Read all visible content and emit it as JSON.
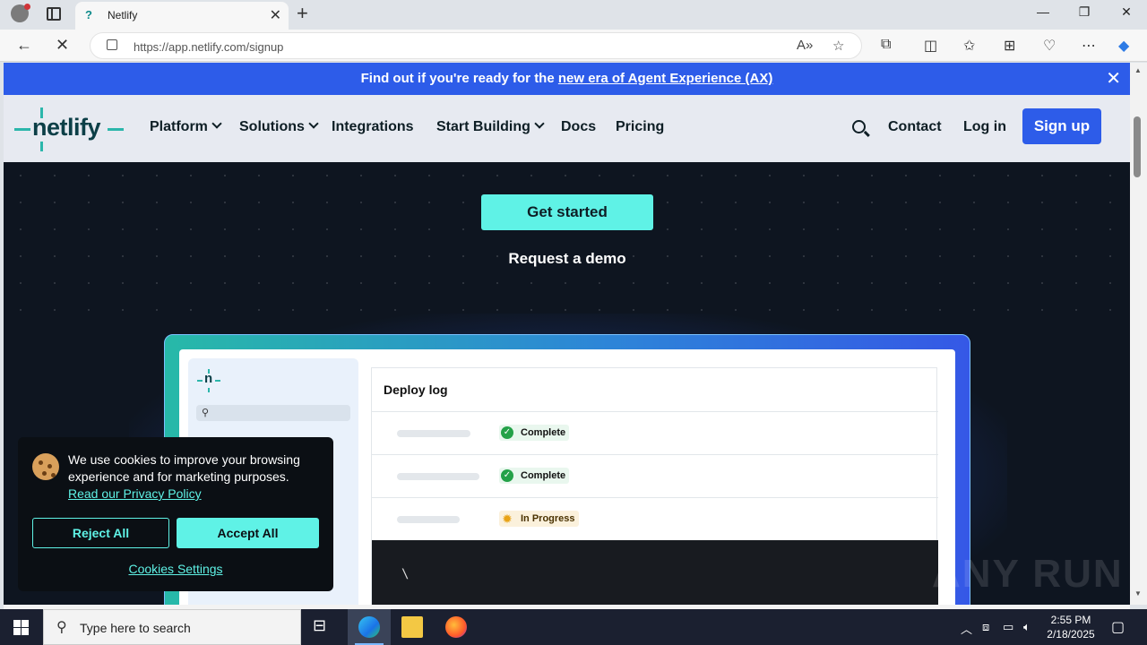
{
  "browser": {
    "tab_title": "Netlify",
    "tab_favicon": "?",
    "new_tab_symbol": "+",
    "url": "https://app.netlify.com/signup",
    "window_controls": [
      "—",
      "❐",
      "✕"
    ],
    "back_symbol": "←",
    "reload_symbol": "✕",
    "close_tab_symbol": "✕"
  },
  "banner": {
    "prefix": "Find out if you're ready for the ",
    "link": "new era of Agent Experience (AX)",
    "close_symbol": "✕"
  },
  "header": {
    "logo_text": "netlify",
    "nav": [
      "Platform",
      "Solutions",
      "Integrations",
      "Start Building",
      "Docs",
      "Pricing"
    ],
    "contact": "Contact",
    "login": "Log in",
    "signup": "Sign up"
  },
  "hero": {
    "cta_primary": "Get started",
    "cta_secondary": "Request a demo"
  },
  "deploy_preview": {
    "mini_logo": "n",
    "title": "Deploy log",
    "rows": [
      {
        "status": "Complete",
        "state": "complete"
      },
      {
        "status": "Complete",
        "state": "complete"
      },
      {
        "status": "In Progress",
        "state": "in-progress"
      }
    ],
    "terminal_text": "\\"
  },
  "cookie": {
    "message": "We use cookies to improve your browsing experience and for marketing purposes.",
    "policy_link": "Read our Privacy Policy",
    "reject": "Reject All",
    "accept": "Accept All",
    "settings": "Cookies Settings"
  },
  "watermark": "ANY RUN",
  "taskbar": {
    "search_placeholder": "Type here to search",
    "time": "2:55 PM",
    "date": "2/18/2025"
  },
  "colors": {
    "accent_blue": "#2d5ce9",
    "accent_teal": "#5ff2e6",
    "page_dark": "#0e1520"
  }
}
